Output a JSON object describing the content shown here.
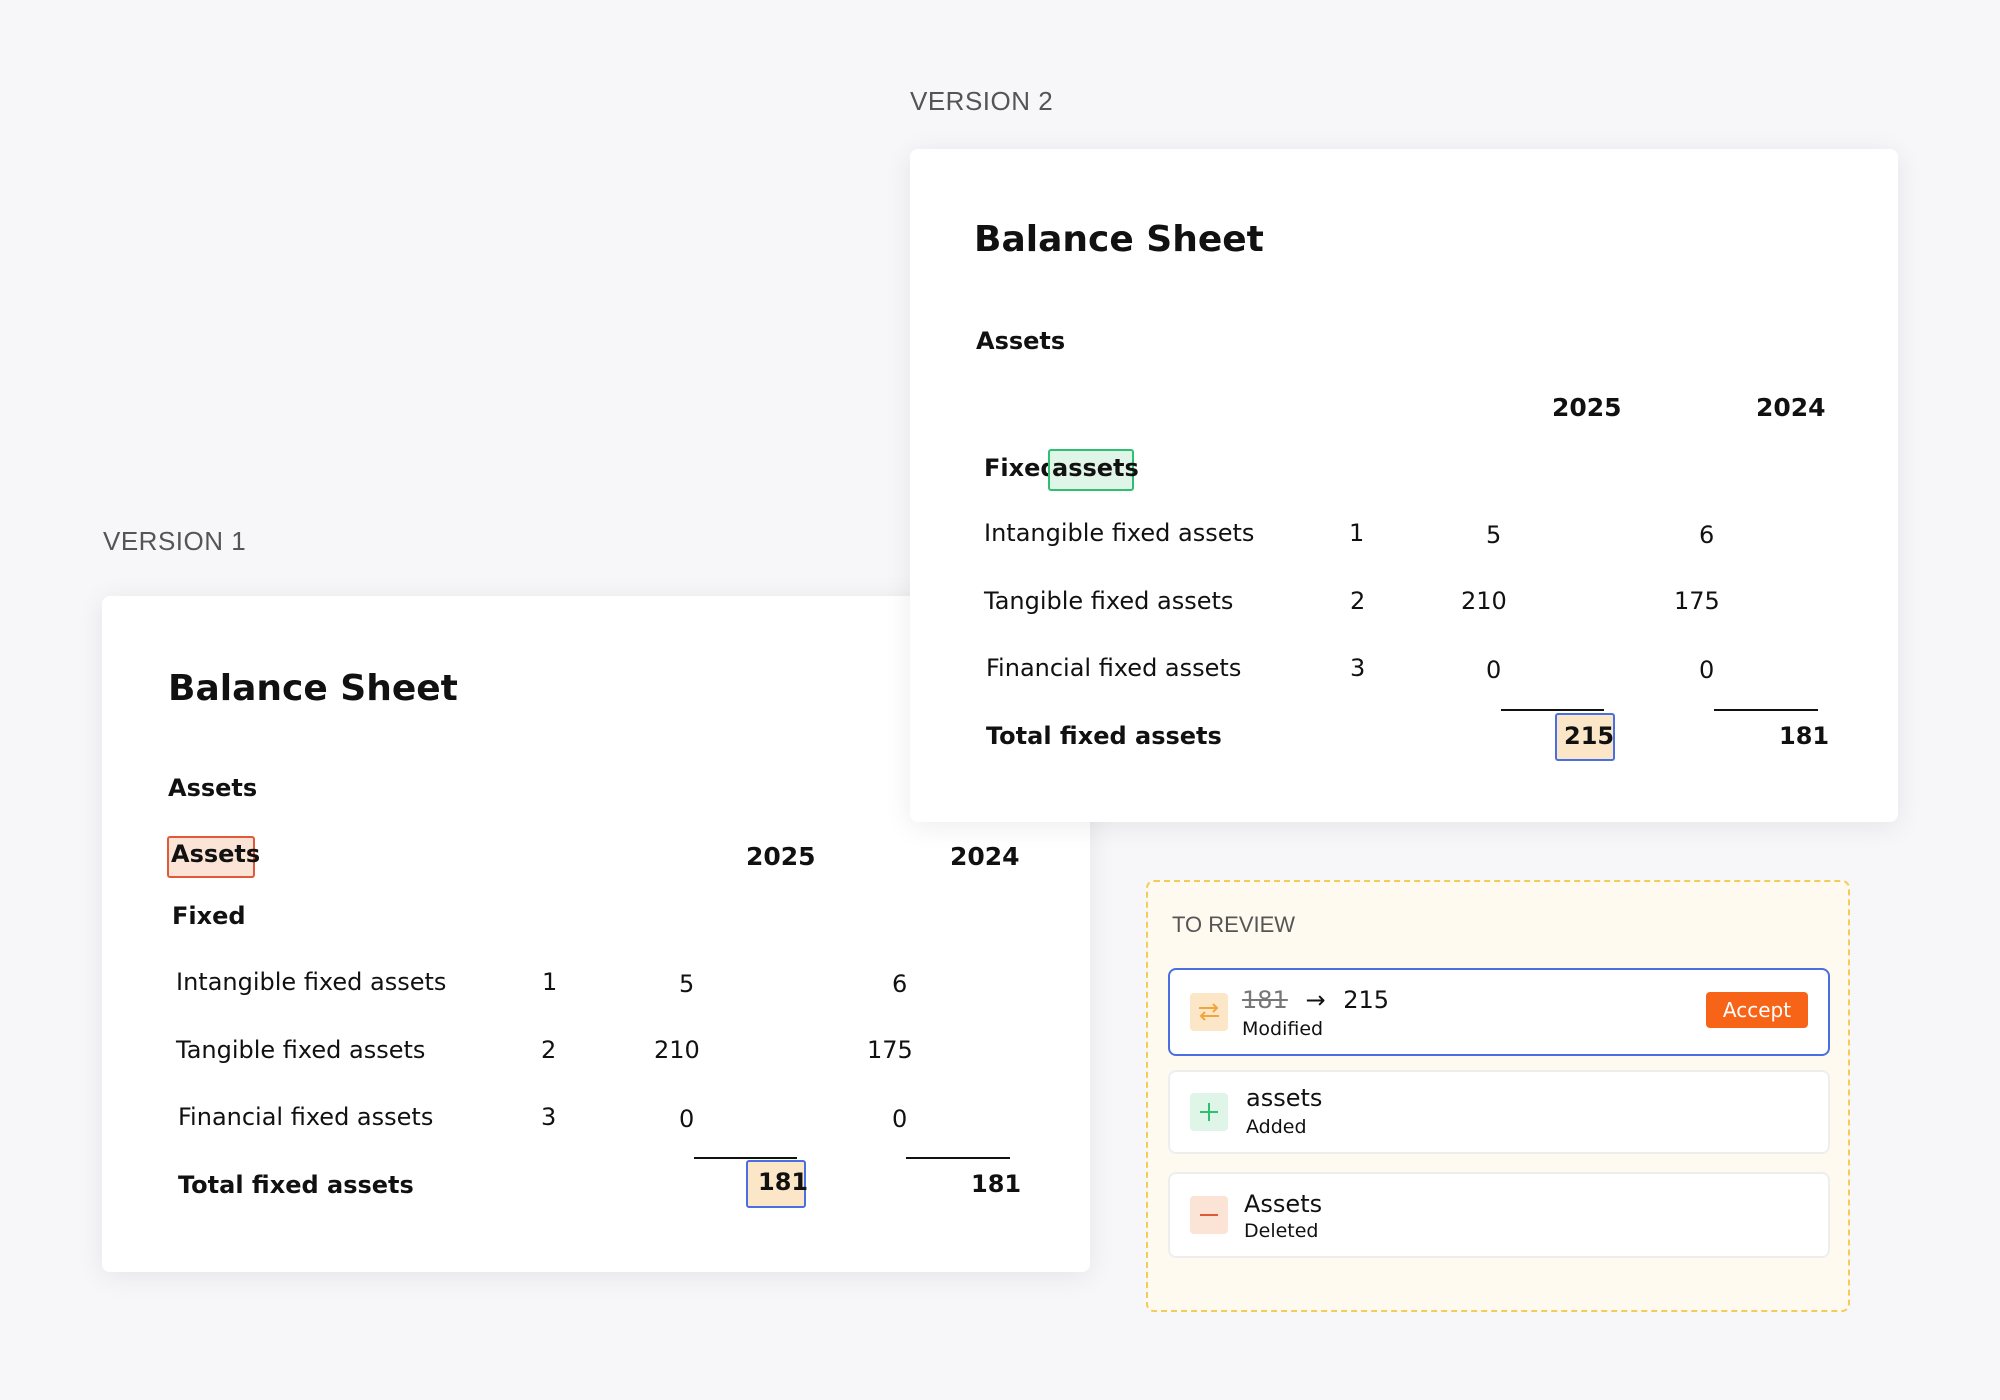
{
  "versions": {
    "v1_label": "VERSION 1",
    "v2_label": "VERSION 2"
  },
  "v1": {
    "title": "Balance Sheet",
    "section": "Assets",
    "deleted_word": "Assets",
    "year1": "2025",
    "year2": "2024",
    "group": "Fixed",
    "rows": [
      {
        "label": "Intangible fixed assets",
        "note": "1",
        "y2025": "5",
        "y2024": "6"
      },
      {
        "label": "Tangible fixed assets",
        "note": "2",
        "y2025": "210",
        "y2024": "175"
      },
      {
        "label": "Financial fixed assets",
        "note": "3",
        "y2025": "0",
        "y2024": "0"
      }
    ],
    "total_label": "Total fixed assets",
    "total_2025": "181",
    "total_2024": "181"
  },
  "v2": {
    "title": "Balance Sheet",
    "section": "Assets",
    "year1": "2025",
    "year2": "2024",
    "group_word": "Fixed",
    "added_word": "assets",
    "rows": [
      {
        "label": "Intangible fixed assets",
        "note": "1",
        "y2025": "5",
        "y2024": "6"
      },
      {
        "label": "Tangible fixed assets",
        "note": "2",
        "y2025": "210",
        "y2024": "175"
      },
      {
        "label": "Financial fixed assets",
        "note": "3",
        "y2025": "0",
        "y2024": "0"
      }
    ],
    "total_label": "Total fixed assets",
    "total_2025": "215",
    "total_2024": "181"
  },
  "review": {
    "title": "TO REVIEW",
    "items": [
      {
        "old": "181",
        "arrow": "→",
        "new": "215",
        "status": "Modified",
        "action": "Accept",
        "icon": "swap-arrows-icon"
      },
      {
        "text": "assets",
        "status": "Added",
        "icon": "plus-icon"
      },
      {
        "text": "Assets",
        "status": "Deleted",
        "icon": "minus-icon"
      }
    ]
  },
  "colors": {
    "accent": "#f76418",
    "added": "#2fbf71",
    "deleted": "#e05a3a",
    "modified_border": "#4a6fe0",
    "review_border": "#f3cc5a"
  }
}
